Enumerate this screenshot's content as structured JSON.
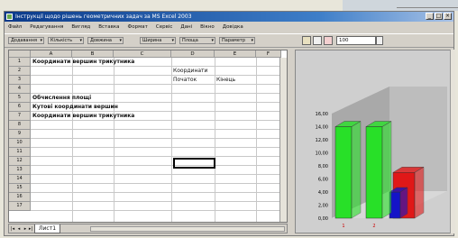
{
  "window": {
    "title": "Інструкції щодо рішень геометричних задач за MS Excel 2003",
    "controls": [
      "_",
      "□",
      "×"
    ]
  },
  "menu": {
    "items": [
      "Файл",
      "Редагування",
      "Вигляд",
      "Вставка",
      "Формат",
      "Сервіс",
      "Дані",
      "Вікно",
      "Довідка"
    ]
  },
  "toolbar": {
    "dropdowns": [
      "Додавання",
      "Кількість",
      "Довжина",
      "Ширина",
      "Площа",
      "Параметр"
    ],
    "zoom_value": "100"
  },
  "sheet": {
    "columns": [
      "A",
      "B",
      "C",
      "D",
      "E",
      "F"
    ],
    "rows": [
      "1",
      "2",
      "3",
      "4",
      "5",
      "6",
      "7",
      "8",
      "9",
      "10",
      "11",
      "12",
      "13",
      "14",
      "15",
      "16",
      "17"
    ],
    "cells": {
      "a1": "Координати вершин трикутника",
      "d2": "Координати",
      "d3": "Початок",
      "e3": "Кінець",
      "a4": "Обчислення площі",
      "a5": "Кутові координати вершин",
      "a6": "Координати вершин трикутника"
    },
    "tab_name": "Лист1",
    "tab_arrows": [
      "|◂",
      "◂",
      "▸",
      "▸|"
    ]
  },
  "chart_data": {
    "type": "bar",
    "categories": [
      "1",
      "2"
    ],
    "series": [
      {
        "values": [
          14,
          14
        ]
      },
      {
        "values": [
          4,
          7
        ]
      }
    ],
    "yticks": [
      "16,00",
      "14,00",
      "12,00",
      "10,00",
      "8,00",
      "6,00",
      "4,00",
      "2,00",
      "0,00"
    ],
    "ylim": [
      0,
      16
    ],
    "colors": [
      "#28e028",
      "#e01818",
      "#1414c8"
    ]
  }
}
